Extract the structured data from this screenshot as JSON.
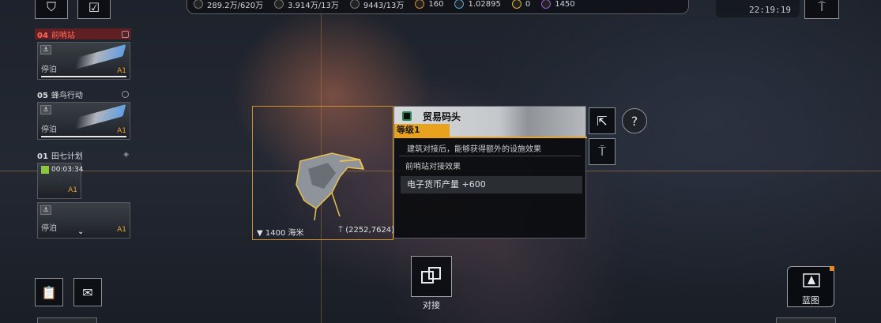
{
  "top_bar": {
    "resources": [
      {
        "icon": "credits-icon",
        "value": "289.2万/620万"
      },
      {
        "icon": "metal-icon",
        "value": "3.914万/13万"
      },
      {
        "icon": "crystal-icon",
        "value": "9443/13万"
      }
    ],
    "orange_value": "160",
    "blue_value": "1.02895",
    "yellow_value": "0",
    "purple_value": "1450"
  },
  "clock": "22:19:19",
  "fleets": [
    {
      "num": "04",
      "name": "前哨站",
      "state": "停泊",
      "tier": "A1",
      "active": true
    },
    {
      "num": "05",
      "name": "蜂鸟行动",
      "state": "停泊",
      "tier": "A1",
      "active": false
    },
    {
      "num": "01",
      "name": "田七计划",
      "timer": "00:03:34",
      "tier": "A1",
      "state": "停泊",
      "tier2": "A1",
      "active": false
    }
  ],
  "target": {
    "distance": "1400 海米",
    "coords": "(2252,7624)"
  },
  "info": {
    "title": "贸易码头",
    "level": "等级1",
    "desc": "建筑对接后，能够获得额外的设施效果",
    "dock_effect_label": "前哨站对接效果",
    "bonus": "电子货币产量 +600"
  },
  "dock_button": {
    "label": "对接"
  },
  "blueprint_button": {
    "label": "蓝图"
  },
  "colors": {
    "accent": "#e8a21e",
    "alert": "#ff6a5a",
    "bracket": "#d09030"
  }
}
